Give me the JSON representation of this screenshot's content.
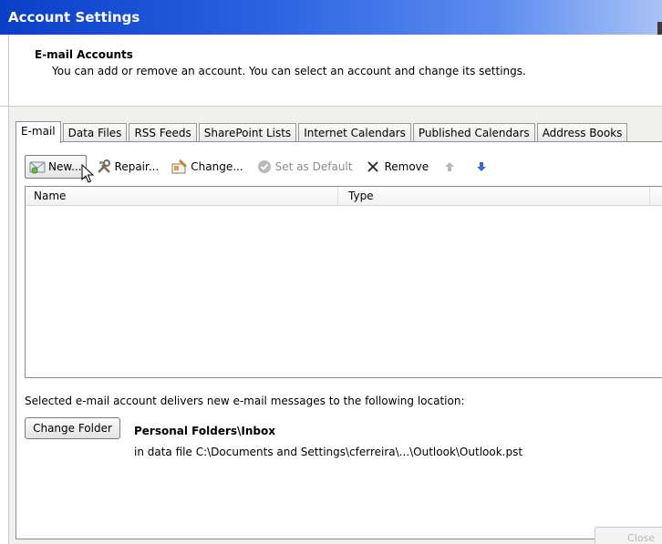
{
  "window": {
    "title": "Account Settings"
  },
  "header": {
    "title": "E-mail Accounts",
    "description": "You can add or remove an account. You can select an account and change its settings."
  },
  "tabs": [
    {
      "label": "E-mail",
      "active": true
    },
    {
      "label": "Data Files"
    },
    {
      "label": "RSS Feeds"
    },
    {
      "label": "SharePoint Lists"
    },
    {
      "label": "Internet Calendars"
    },
    {
      "label": "Published Calendars"
    },
    {
      "label": "Address Books"
    }
  ],
  "toolbar": {
    "new": {
      "label": "New...",
      "icon": "new-account-icon"
    },
    "repair": {
      "label": "Repair...",
      "icon": "repair-tools-icon"
    },
    "change": {
      "label": "Change...",
      "icon": "change-account-icon"
    },
    "set_default": {
      "label": "Set as Default",
      "icon": "checkmark-circle-icon",
      "enabled": false
    },
    "remove": {
      "label": "Remove",
      "icon": "remove-x-icon"
    },
    "move_up": {
      "icon": "arrow-up-icon",
      "enabled": false
    },
    "move_down": {
      "icon": "arrow-down-icon"
    }
  },
  "account_list": {
    "columns": [
      "Name",
      "Type"
    ],
    "rows": []
  },
  "delivery": {
    "label": "Selected e-mail account delivers new e-mail messages to the following location:",
    "change_folder_button": "Change Folder",
    "folder": "Personal Folders\\Inbox",
    "data_file": "in data file C:\\Documents and Settings\\cferreira\\...\\Outlook\\Outlook.pst"
  },
  "footer": {
    "close_label": "Close"
  },
  "colors": {
    "titlebar_start": "#0a3fc8",
    "titlebar_end": "#a8c2f5",
    "dialog_background": "#f0f0ed",
    "disabled_text": "#8c8c8c",
    "down_arrow": "#3a6ad8"
  }
}
